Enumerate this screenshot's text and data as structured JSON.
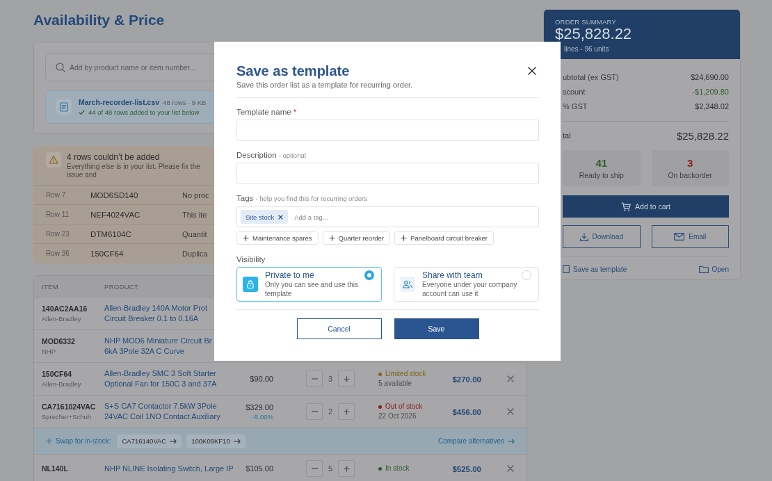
{
  "page": {
    "title": "Availability & Price"
  },
  "upload": {
    "search": {
      "placeholder": "Add by product name or item number..."
    },
    "file": {
      "name": "March-recorder-list.csv",
      "meta": "48 rows · 9 KB",
      "status": "44 of 48 rows added to your list below"
    }
  },
  "import_errors": {
    "title": "4 rows couldn’t be added",
    "message": "Everything else is in your list. Please fix the issue and",
    "rows": [
      {
        "row": "Row 7",
        "item": "MOD6SD140",
        "reason": "No proc"
      },
      {
        "row": "Row 11",
        "item": "NEF4024VAC",
        "reason": "This ite"
      },
      {
        "row": "Row 23",
        "item": "DTM6104C",
        "reason": "Quantit"
      },
      {
        "row": "Row 36",
        "item": "150CF64",
        "reason": "Duplica"
      }
    ]
  },
  "table": {
    "columns": [
      "ITEM",
      "PRODUCT"
    ],
    "rows": [
      {
        "kind": "item",
        "item": "140AC2AA16",
        "brand": "Allen-Bradley",
        "product": [
          "Allen-Bradley 140A Motor Prot",
          "Circuit Breaker 0.1 to 0.16A"
        ]
      },
      {
        "kind": "item",
        "item": "MOD6332",
        "brand": "NHP",
        "product": [
          "NHP MOD6 Miniature Circuit Br",
          "6kA 3Pole 32A C Curve"
        ]
      },
      {
        "kind": "item",
        "item": "150CF64",
        "brand": "Allen-Bradley",
        "product": [
          "Allen-Bradley SMC 3 Soft Starter",
          "Optional Fan for 150C 3 and 37A"
        ],
        "price": "$90.00",
        "quantity": "3",
        "stock": {
          "label": "Limited stock",
          "note": "5 available",
          "color": "#7a6416"
        },
        "total": "$270.00"
      },
      {
        "kind": "item",
        "item": "CA7161024VAC",
        "brand": "Sprecher+Schuh",
        "product": [
          "S+S CA7 Contactor 7.5kW 3Pole",
          "24VAC Coil 1NO Contact Auxiliary"
        ],
        "price": "$329.00",
        "discount": "-5.00%",
        "quantity": "2",
        "stock": {
          "label": "Out of stock",
          "note": "22 Oct 2026",
          "color": "#8c1d21"
        },
        "total": "$456.00"
      },
      {
        "kind": "swap",
        "label": "Swap for in-stock:",
        "options": [
          "CA716140VAC",
          "100K09KF10"
        ],
        "link": "Compare alternatives"
      },
      {
        "kind": "item",
        "item": "NL140L",
        "product": [
          "NHP NLINE Isolating Switch, Large IP"
        ],
        "price": "$105.00",
        "quantity": "5",
        "stock": {
          "label": "In stock",
          "color": "#2c5d2e"
        },
        "total": "$525.00"
      }
    ]
  },
  "summary": {
    "title": "ORDER SUMMARY",
    "total": "$25,828.22",
    "subtitle": "lines - 96 units",
    "lines": [
      {
        "kind": "plain",
        "label": "ubtotal (ex GST)",
        "value": "$24,690.00"
      },
      {
        "kind": "discount",
        "label": "scount",
        "value": "-$1,209.80"
      },
      {
        "kind": "plain",
        "label": "% GST",
        "value": "$2,348.02"
      }
    ],
    "total_row": {
      "label": "tal",
      "value": "$25,828.22"
    },
    "stats": [
      {
        "value": "41",
        "label": "Ready to ship",
        "color": "#2e5e2f"
      },
      {
        "value": "3",
        "label": "On backorder",
        "color": "#8e1b1f"
      }
    ],
    "primary_action": "Add to cart",
    "actions": [
      {
        "kind": "download",
        "label": "Download"
      },
      {
        "kind": "email",
        "label": "Email"
      }
    ],
    "links": [
      {
        "kind": "template",
        "label": "Save as template"
      },
      {
        "kind": "open",
        "label": "Open"
      }
    ]
  },
  "modal": {
    "title": "Save as template",
    "subtitle": "Save this order list as a template for recurring order.",
    "fields": [
      {
        "kind": "text",
        "label": "Template name",
        "required_mark": "*"
      },
      {
        "kind": "text",
        "label": "Description",
        "note": "- optional"
      },
      {
        "kind": "tags",
        "label": "Tags",
        "note": "- help you find this for recurring orders",
        "tags": [
          "Site stock"
        ],
        "placeholder": "Add a tag...",
        "suggestions": [
          "Maintenance spares",
          "Quarter reorder",
          "Panelboard circuit breaker"
        ]
      }
    ],
    "visibility": {
      "label": "Visibility",
      "options": [
        {
          "kind": "private",
          "title": "Private to me",
          "description": "Only you can see and use this template",
          "selected": true
        },
        {
          "kind": "team",
          "title": "Share with team",
          "description": "Everyone under your company account can use it",
          "selected": false
        }
      ]
    },
    "buttons": [
      {
        "kind": "cancel",
        "label": "Cancel"
      },
      {
        "kind": "save",
        "label": "Save"
      }
    ]
  }
}
